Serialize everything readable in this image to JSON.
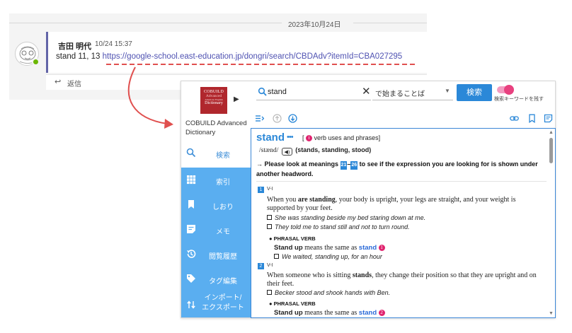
{
  "chat": {
    "date": "2023年10月24日",
    "author": "吉田 明代",
    "time": "10/24 15:37",
    "message_prefix": "stand 11, 13 ",
    "message_link": "https://google-school.east-education.jp/dongri/search/CBDAdv?itemId=CBA027295",
    "reply_label": "返信"
  },
  "app": {
    "book_cover": [
      "COBUILD",
      "Advanced",
      "American English",
      "Dictionary"
    ],
    "dictionary_name": "COBUILD Advanced Dictionary",
    "nav": [
      {
        "label": "検索",
        "icon": "search-icon"
      },
      {
        "label": "索引",
        "icon": "grid-icon"
      },
      {
        "label": "しおり",
        "icon": "bookmark-icon"
      },
      {
        "label": "メモ",
        "icon": "memo-icon"
      },
      {
        "label": "閲覧履歴",
        "icon": "history-icon"
      },
      {
        "label": "タグ編集",
        "icon": "tag-icon"
      },
      {
        "label": "インポート/\nエクスポート",
        "icon": "import-export-icon"
      }
    ],
    "search": {
      "value": "stand",
      "mode": "で始まることば",
      "button_label": "検索",
      "toggle_label": "検索キーワードを残す",
      "toggle_on": true
    },
    "entry": {
      "headword": "stand",
      "frequency": "•••",
      "bracket_open": "[",
      "info_badge": "i",
      "bracket_text": "verb uses and phrases",
      "bracket_close": "]",
      "pronunciation": "/stænd/",
      "forms": "(stands, standing, stood)",
      "note_before": "→ Please look at meanings ",
      "note_range_start": "21",
      "note_range_dash": "–",
      "note_range_end": "26",
      "note_after": " to see if the expression you are looking for is shown under another headword.",
      "senses": [
        {
          "number": "1",
          "grammar": "V-I",
          "definition_pre": "When you ",
          "definition_bold": "are standing",
          "definition_post": ", your body is upright, your legs are straight, and your weight is supported by your feet.",
          "examples": [
            "She was standing beside my bed staring down at me.",
            "They told me to stand still and not to turn round."
          ],
          "phrasal_label": "● PHRASAL VERB",
          "phrasal_bold": "Stand up",
          "phrasal_mid": " means the same as ",
          "phrasal_xref": "stand",
          "phrasal_badge": "1",
          "phrasal_example": "We waited, standing up, for an hour"
        },
        {
          "number": "2",
          "grammar": "V-I",
          "definition_pre": "When someone who is sitting ",
          "definition_bold": "stands",
          "definition_post": ", they change their position so that they are upright and on their feet.",
          "examples": [
            "Becker stood and shook hands with Ben."
          ],
          "phrasal_label": "● PHRASAL VERB",
          "phrasal_bold": "Stand up",
          "phrasal_mid": " means the same as ",
          "phrasal_xref": "stand",
          "phrasal_badge": "2"
        }
      ]
    }
  },
  "colors": {
    "sidebar": "#5aaef0",
    "accent": "#2b88d8",
    "annotation": "#e0504f",
    "teams_purple": "#6264a7"
  }
}
